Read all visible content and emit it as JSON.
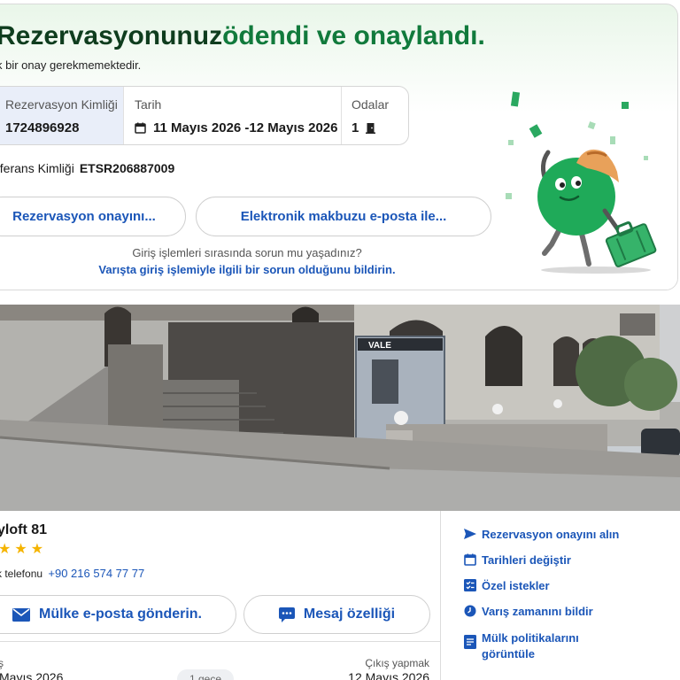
{
  "confirmation": {
    "headline_part1": "Rezervasyonunuz",
    "headline_part2": "ödendi ve onaylandı.",
    "subline": "k bir onay gerekmemektedir.",
    "reservation_id_label": "Rezervasyon Kimliği",
    "reservation_id": "1724896928",
    "date_label": "Tarih",
    "date_value": "11 Mayıs 2026 -12 Mayıs 2026",
    "rooms_label": "Odalar",
    "rooms_value": "1",
    "reference_label": "eferans Kimliği",
    "reference_value": "ETSR206887009",
    "button_confirmation": "Rezervasyon onayını...",
    "button_receipt": "Elektronik makbuzu e-posta ile...",
    "help_question": "Giriş işlemleri sırasında sorun mu yaşadınız?",
    "help_link": "Varışta giriş işlemiyle ilgili bir sorun olduğunu bildirin."
  },
  "photo": {
    "sign_vale": "VALE"
  },
  "hotel": {
    "name": "yloft 81",
    "stars": "★★★",
    "phone_label": "k telefonu",
    "phone_number": "+90 216 574 77 77",
    "email_button": "Mülke e-posta gönderin.",
    "message_button": "Mesaj özelliği",
    "checkin_label": "ş",
    "checkin_date": "Mayıs 2026",
    "nights": "1 gece",
    "checkout_label": "Çıkış yapmak",
    "checkout_date": "12 Mayıs 2026"
  },
  "side_menu": {
    "get_confirmation": "Rezervasyon onayını alın",
    "change_dates": "Tarihleri değiştir",
    "special_requests": "Özel istekler",
    "arrival_time": "Varış zamanını bildir",
    "policies": "Mülk politikalarını görüntüle"
  },
  "colors": {
    "link_blue": "#1b56b8",
    "headline_green": "#117a3c",
    "star_yellow": "#f5b400",
    "mascot_green": "#1faa59"
  }
}
